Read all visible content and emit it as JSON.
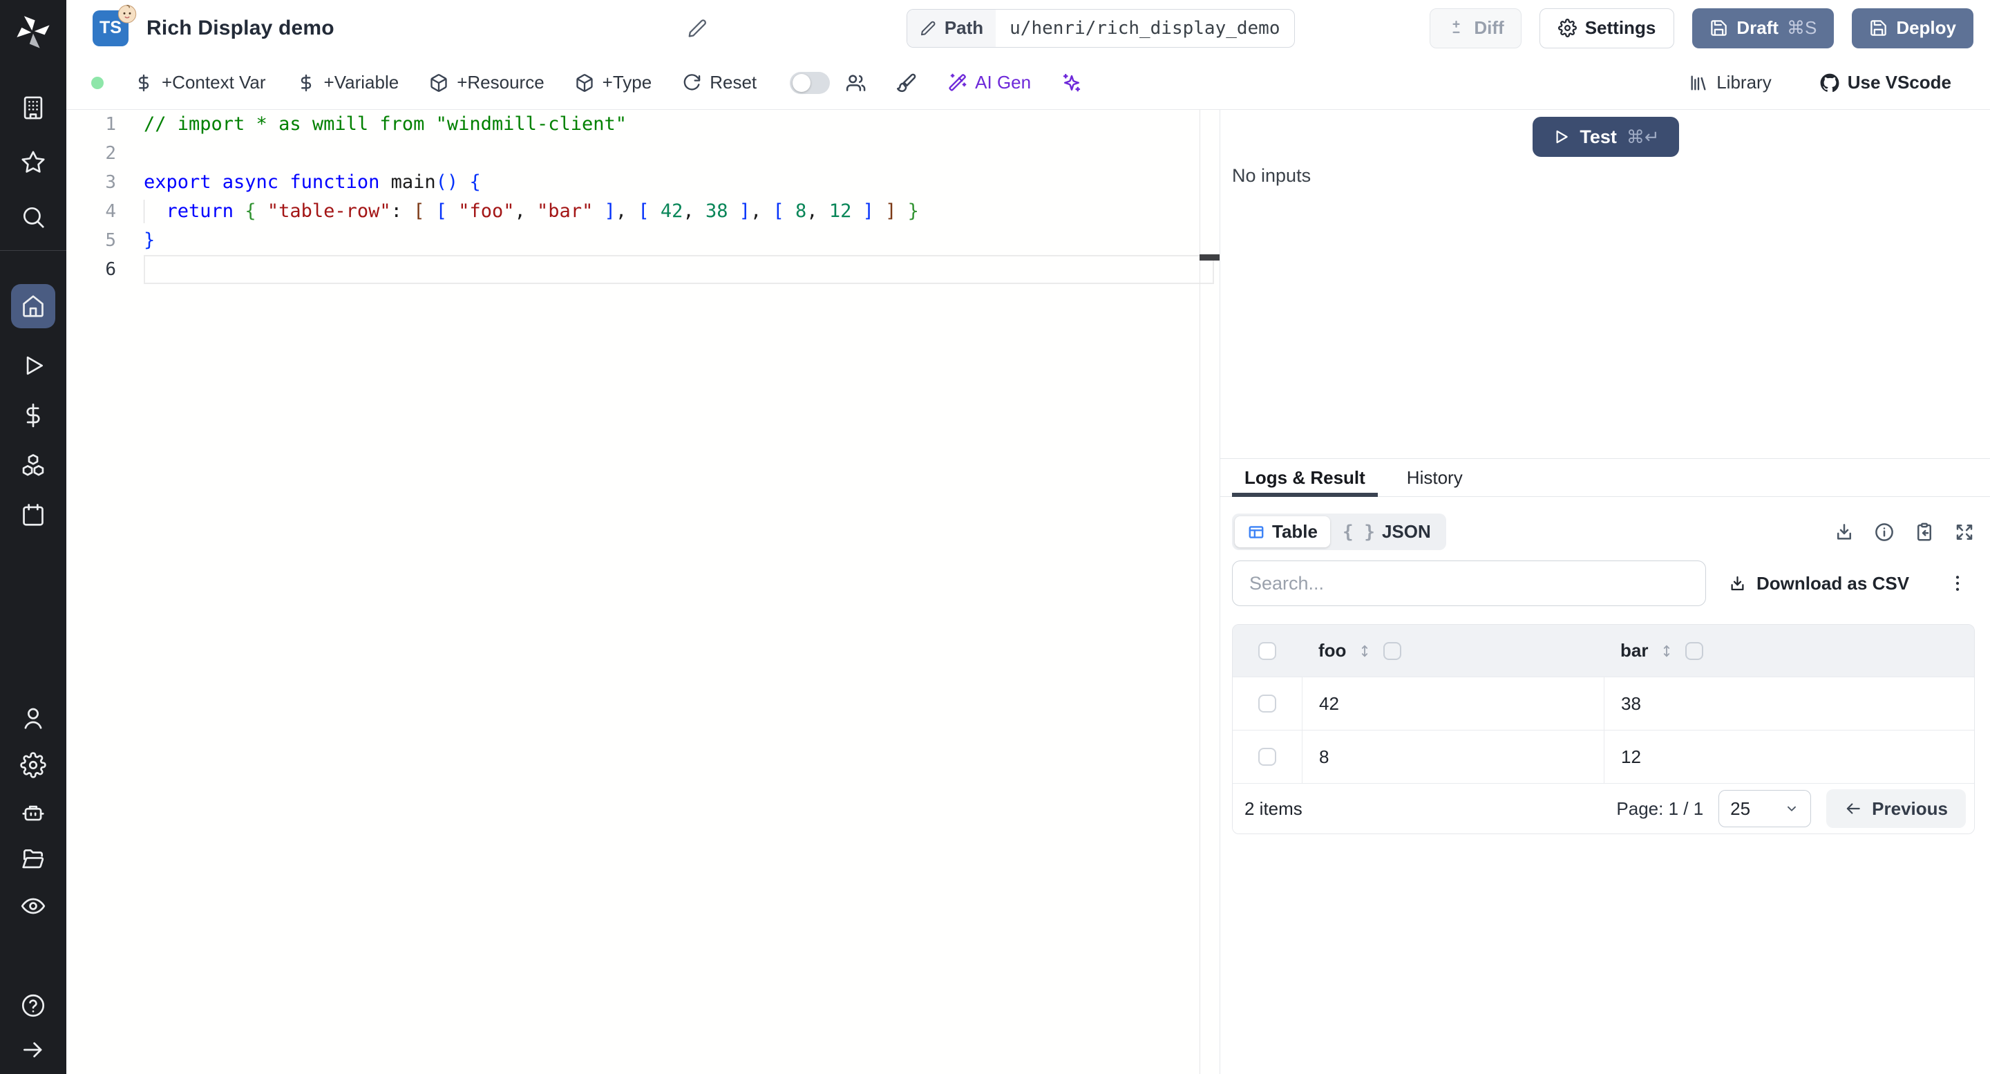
{
  "header": {
    "badge": "TS",
    "title": "Rich Display demo",
    "path_label": "Path",
    "path_value": "u/henri/rich_display_demo",
    "diff": "Diff",
    "settings": "Settings",
    "draft": "Draft",
    "draft_shortcut": "⌘S",
    "deploy": "Deploy"
  },
  "toolbar": {
    "context_var": "+Context Var",
    "variable": "+Variable",
    "resource": "+Resource",
    "type": "+Type",
    "reset": "Reset",
    "ai_gen": "AI Gen",
    "library": "Library",
    "use_vscode": "Use VScode"
  },
  "editor": {
    "lines": [
      {
        "num": "1",
        "tokens": [
          [
            "// import * as wmill from \"windmill-client\"",
            "comment"
          ]
        ]
      },
      {
        "num": "2",
        "tokens": []
      },
      {
        "num": "3",
        "tokens": [
          [
            "export async function",
            "kw"
          ],
          [
            " main",
            "plain"
          ],
          [
            "(",
            "b1"
          ],
          [
            ")",
            "b1"
          ],
          [
            " ",
            "plain"
          ],
          [
            "{",
            "b1"
          ]
        ]
      },
      {
        "num": "4",
        "tokens": [
          [
            "  ",
            "plain"
          ],
          [
            "return",
            "kw"
          ],
          [
            " ",
            "plain"
          ],
          [
            "{",
            "b2"
          ],
          [
            " ",
            "plain"
          ],
          [
            "\"table-row\"",
            "str"
          ],
          [
            ": ",
            "plain"
          ],
          [
            "[",
            "b3"
          ],
          [
            " ",
            "plain"
          ],
          [
            "[",
            "b1"
          ],
          [
            " ",
            "plain"
          ],
          [
            "\"foo\"",
            "str"
          ],
          [
            ", ",
            "plain"
          ],
          [
            "\"bar\"",
            "str"
          ],
          [
            " ",
            "plain"
          ],
          [
            "]",
            "b1"
          ],
          [
            ", ",
            "plain"
          ],
          [
            "[",
            "b1"
          ],
          [
            " ",
            "plain"
          ],
          [
            "42",
            "num"
          ],
          [
            ", ",
            "plain"
          ],
          [
            "38",
            "num"
          ],
          [
            " ",
            "plain"
          ],
          [
            "]",
            "b1"
          ],
          [
            ", ",
            "plain"
          ],
          [
            "[",
            "b1"
          ],
          [
            " ",
            "plain"
          ],
          [
            "8",
            "num"
          ],
          [
            ", ",
            "plain"
          ],
          [
            "12",
            "num"
          ],
          [
            " ",
            "plain"
          ],
          [
            "]",
            "b1"
          ],
          [
            " ",
            "plain"
          ],
          [
            "]",
            "b3"
          ],
          [
            " ",
            "plain"
          ],
          [
            "}",
            "b2"
          ]
        ]
      },
      {
        "num": "5",
        "tokens": [
          [
            "}",
            "b1"
          ]
        ]
      },
      {
        "num": "6",
        "tokens": []
      }
    ]
  },
  "preview": {
    "test": "Test",
    "test_shortcut": "⌘↵",
    "no_inputs": "No inputs"
  },
  "results": {
    "tab_logs": "Logs & Result",
    "tab_history": "History",
    "view_table": "Table",
    "view_json_icon": "{ }",
    "view_json": "JSON",
    "search_placeholder": "Search...",
    "download_csv": "Download as CSV",
    "table": {
      "columns": [
        "foo",
        "bar"
      ],
      "rows": [
        [
          "42",
          "38"
        ],
        [
          "8",
          "12"
        ]
      ]
    },
    "footer": {
      "count": "2 items",
      "page": "Page: 1 / 1",
      "page_size": "25",
      "previous": "Previous"
    }
  },
  "colors": {
    "accent_blue": "#3c82f6",
    "ai_purple": "#6d28d9",
    "button_slate": "#5e7296",
    "test_navy": "#3c4d70",
    "status_green": "#8ee6a9",
    "ts_badge_blue": "#3178c6"
  }
}
